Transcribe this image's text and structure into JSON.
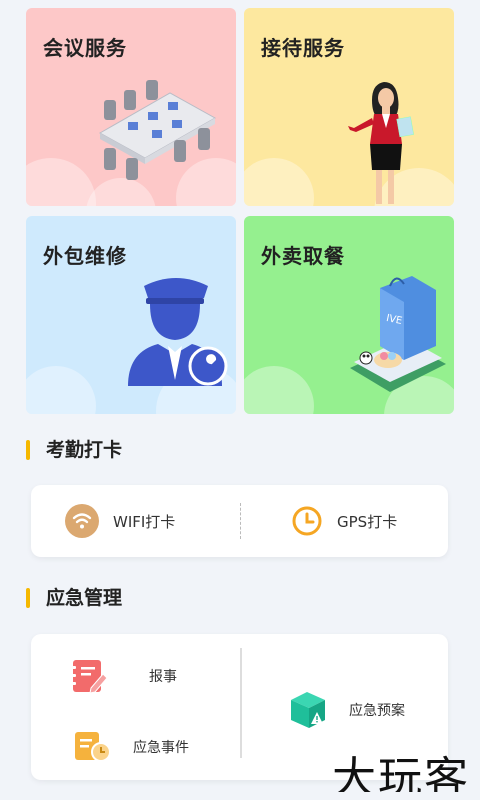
{
  "tiles": [
    {
      "title": "会议服务",
      "icon": "meeting-room-illustration"
    },
    {
      "title": "接待服务",
      "icon": "receptionist-illustration"
    },
    {
      "title": "外包维修",
      "icon": "repair-worker-illustration"
    },
    {
      "title": "外卖取餐",
      "icon": "takeout-bag-illustration"
    }
  ],
  "attendance": {
    "title": "考勤打卡",
    "items": [
      {
        "label": "WIFI打卡",
        "icon": "wifi-icon",
        "color": "#dba870"
      },
      {
        "label": "GPS打卡",
        "icon": "clock-icon",
        "color": "#f5a623"
      }
    ]
  },
  "emergency": {
    "title": "应急管理",
    "items": [
      {
        "label": "报事",
        "icon": "notebook-pen-icon",
        "color": "#f26b6b"
      },
      {
        "label": "应急事件",
        "icon": "document-clock-icon",
        "color": "#f5b23d"
      },
      {
        "label": "应急预案",
        "icon": "box-warning-icon",
        "color": "#1fbf9a"
      }
    ]
  },
  "watermark": "大玩客",
  "colors": {
    "accent": "#f5b800",
    "tile_red": "#fdc8c8",
    "tile_yellow": "#fde89f",
    "tile_blue": "#cfeafd",
    "tile_green": "#95f08f"
  }
}
